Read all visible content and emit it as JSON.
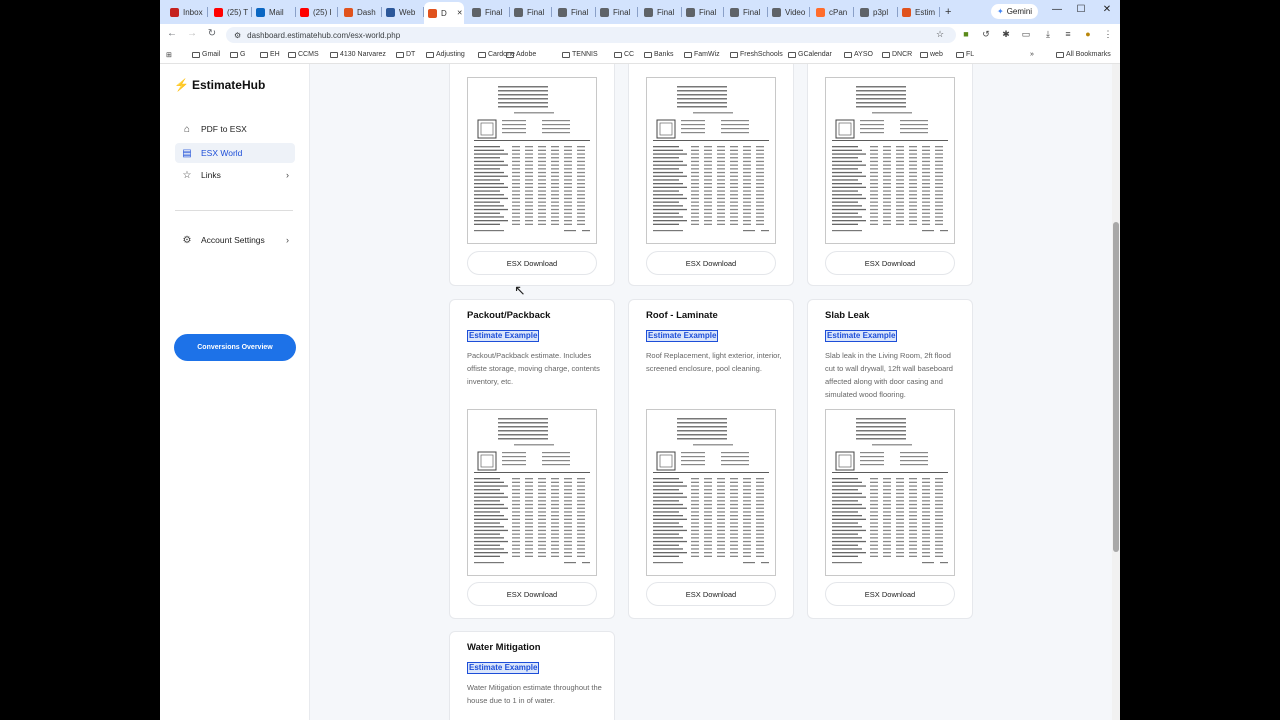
{
  "browser": {
    "tabs": [
      {
        "label": "Inbox",
        "color": "#c5221f"
      },
      {
        "label": "(25) T",
        "color": "#ff0000"
      },
      {
        "label": "Mail",
        "color": "#0a66c2"
      },
      {
        "label": "(25) I",
        "color": "#ff0000"
      },
      {
        "label": "Dash",
        "color": "#e0521d"
      },
      {
        "label": "Web",
        "color": "#2b579a"
      },
      {
        "label": "D",
        "color": "#e0521d",
        "active": true
      },
      {
        "label": "Final",
        "color": "#5f6368"
      },
      {
        "label": "Final",
        "color": "#5f6368"
      },
      {
        "label": "Final",
        "color": "#5f6368"
      },
      {
        "label": "Final",
        "color": "#5f6368"
      },
      {
        "label": "Final",
        "color": "#5f6368"
      },
      {
        "label": "Final",
        "color": "#5f6368"
      },
      {
        "label": "Final",
        "color": "#5f6368"
      },
      {
        "label": "Video",
        "color": "#5f6368"
      },
      {
        "label": "cPan",
        "color": "#ff6c2c"
      },
      {
        "label": "p3pl",
        "color": "#5f6368"
      },
      {
        "label": "Estim",
        "color": "#e0521d"
      }
    ],
    "new_tab": "+",
    "gemini_label": "Gemini",
    "url": "dashboard.estimatehub.com/esx-world.php",
    "bookmarks": [
      "Gmail",
      "G",
      "EH",
      "CCMS",
      "4130 Narvarez",
      "DT",
      "Adjusting",
      "Cardone",
      "Adobe",
      "TENNIS",
      "CC",
      "Banks",
      "FamWiz",
      "FreshSchools",
      "GCalendar",
      "AYSO",
      "DNCR",
      "web",
      "FL"
    ],
    "all_bookmarks": "All Bookmarks"
  },
  "sidebar": {
    "brand": "EstimateHub",
    "items": [
      {
        "label": "PDF to ESX",
        "icon": "home-icon"
      },
      {
        "label": "ESX World",
        "icon": "document-icon"
      },
      {
        "label": "Links",
        "icon": "star-icon"
      }
    ],
    "account": "Account Settings",
    "conversions_button": "Conversions Overview"
  },
  "cards_top": [
    {
      "download": "ESX Download"
    },
    {
      "download": "ESX Download"
    },
    {
      "download": "ESX Download"
    }
  ],
  "cards": [
    {
      "title": "Packout/Packback",
      "badge": "Estimate Example",
      "desc": "Packout/Packback estimate. Includes offiste storage, moving charge, contents inventory, etc.",
      "download": "ESX Download"
    },
    {
      "title": "Roof - Laminate",
      "badge": "Estimate Example",
      "desc": "Roof Replacement, light exterior, interior, screened enclosure, pool cleaning.",
      "download": "ESX Download"
    },
    {
      "title": "Slab Leak",
      "badge": "Estimate Example",
      "desc": "Slab leak in the Living Room, 2ft flood cut to wall drywall, 12ft wall baseboard affected along with door casing and simulated wood flooring.",
      "download": "ESX Download"
    },
    {
      "title": "Water Mitigation",
      "badge": "Estimate Example",
      "desc": "Water Mitigation estimate throughout the house due to 1 in of water."
    }
  ]
}
